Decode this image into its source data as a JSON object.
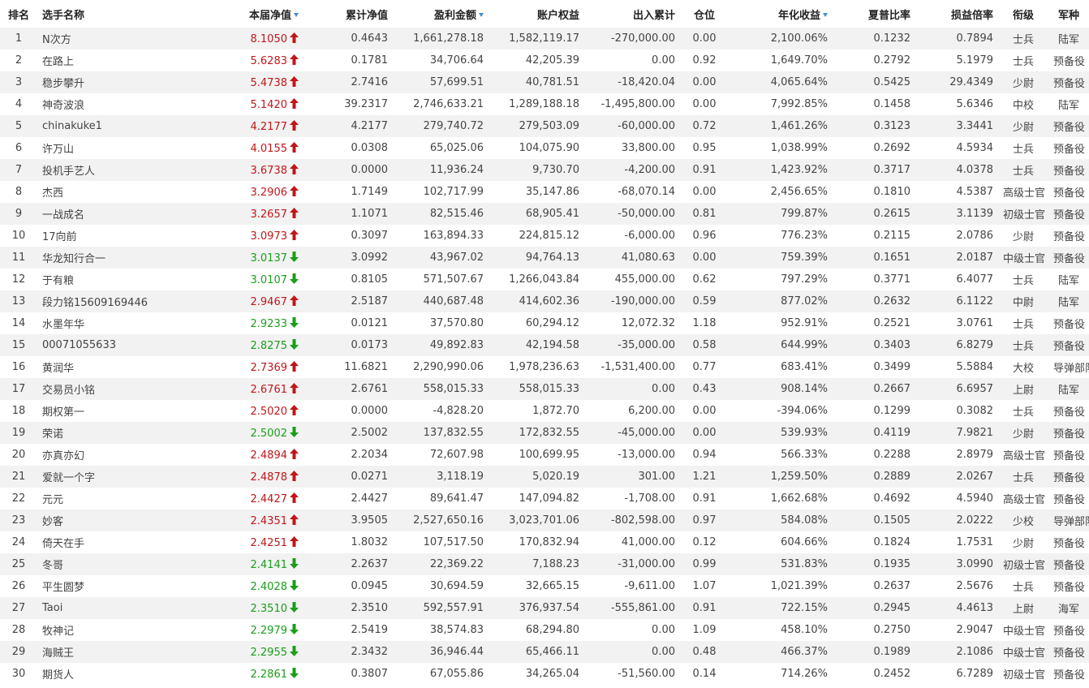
{
  "colors": {
    "up": "#c0161a",
    "down": "#1a9e1a",
    "sort_icon": "#3f8fd2",
    "row_stripe": "#f2f2f2"
  },
  "icons": {
    "up": "arrow-up-icon",
    "down": "arrow-down-icon",
    "sort": "sort-desc-icon"
  },
  "columns": [
    {
      "label": "排名",
      "sortable": false
    },
    {
      "label": "选手名称",
      "sortable": false
    },
    {
      "label": "本届净值",
      "sortable": true
    },
    {
      "label": "累计净值",
      "sortable": false
    },
    {
      "label": "盈利金额",
      "sortable": true
    },
    {
      "label": "账户权益",
      "sortable": false
    },
    {
      "label": "出入累计",
      "sortable": false
    },
    {
      "label": "仓位",
      "sortable": false
    },
    {
      "label": "年化收益",
      "sortable": true
    },
    {
      "label": "夏普比率",
      "sortable": false
    },
    {
      "label": "损益倍率",
      "sortable": false
    },
    {
      "label": "衔级",
      "sortable": false
    },
    {
      "label": "军种",
      "sortable": false
    }
  ],
  "rows": [
    {
      "rank": "1",
      "name": "N次方",
      "nav": "8.1050",
      "trend": "up",
      "cum_nav": "0.4643",
      "profit": "1,661,278.18",
      "equity": "1,582,119.17",
      "flow": "-270,000.00",
      "position": "0.00",
      "annual": "2,100.06%",
      "sharpe": "0.1232",
      "pl_ratio": "0.7894",
      "title": "士兵",
      "branch": "陆军"
    },
    {
      "rank": "2",
      "name": "在路上",
      "nav": "5.6283",
      "trend": "up",
      "cum_nav": "0.1781",
      "profit": "34,706.64",
      "equity": "42,205.39",
      "flow": "0.00",
      "position": "0.92",
      "annual": "1,649.70%",
      "sharpe": "0.2792",
      "pl_ratio": "5.1979",
      "title": "士兵",
      "branch": "预备役"
    },
    {
      "rank": "3",
      "name": "稳步攀升",
      "nav": "5.4738",
      "trend": "up",
      "cum_nav": "2.7416",
      "profit": "57,699.51",
      "equity": "40,781.51",
      "flow": "-18,420.04",
      "position": "0.00",
      "annual": "4,065.64%",
      "sharpe": "0.5425",
      "pl_ratio": "29.4349",
      "title": "少尉",
      "branch": "预备役"
    },
    {
      "rank": "4",
      "name": "神奇波浪",
      "nav": "5.1420",
      "trend": "up",
      "cum_nav": "39.2317",
      "profit": "2,746,633.21",
      "equity": "1,289,188.18",
      "flow": "-1,495,800.00",
      "position": "0.00",
      "annual": "7,992.85%",
      "sharpe": "0.1458",
      "pl_ratio": "5.6346",
      "title": "中校",
      "branch": "陆军"
    },
    {
      "rank": "5",
      "name": "chinakuke1",
      "nav": "4.2177",
      "trend": "up",
      "cum_nav": "4.2177",
      "profit": "279,740.72",
      "equity": "279,503.09",
      "flow": "-60,000.00",
      "position": "0.72",
      "annual": "1,461.26%",
      "sharpe": "0.3123",
      "pl_ratio": "3.3441",
      "title": "少尉",
      "branch": "预备役"
    },
    {
      "rank": "6",
      "name": "许万山",
      "nav": "4.0155",
      "trend": "up",
      "cum_nav": "0.0308",
      "profit": "65,025.06",
      "equity": "104,075.90",
      "flow": "33,800.00",
      "position": "0.95",
      "annual": "1,038.99%",
      "sharpe": "0.2692",
      "pl_ratio": "4.5934",
      "title": "士兵",
      "branch": "预备役"
    },
    {
      "rank": "7",
      "name": "投机手艺人",
      "nav": "3.6738",
      "trend": "up",
      "cum_nav": "0.0000",
      "profit": "11,936.24",
      "equity": "9,730.70",
      "flow": "-4,200.00",
      "position": "0.91",
      "annual": "1,423.92%",
      "sharpe": "0.3717",
      "pl_ratio": "4.0378",
      "title": "士兵",
      "branch": "预备役"
    },
    {
      "rank": "8",
      "name": "杰西",
      "nav": "3.2906",
      "trend": "up",
      "cum_nav": "1.7149",
      "profit": "102,717.99",
      "equity": "35,147.86",
      "flow": "-68,070.14",
      "position": "0.00",
      "annual": "2,456.65%",
      "sharpe": "0.1810",
      "pl_ratio": "4.5387",
      "title": "高级士官",
      "branch": "预备役"
    },
    {
      "rank": "9",
      "name": "一战成名",
      "nav": "3.2657",
      "trend": "up",
      "cum_nav": "1.1071",
      "profit": "82,515.46",
      "equity": "68,905.41",
      "flow": "-50,000.00",
      "position": "0.81",
      "annual": "799.87%",
      "sharpe": "0.2615",
      "pl_ratio": "3.1139",
      "title": "初级士官",
      "branch": "预备役"
    },
    {
      "rank": "10",
      "name": "17向前",
      "nav": "3.0973",
      "trend": "up",
      "cum_nav": "0.3097",
      "profit": "163,894.33",
      "equity": "224,815.12",
      "flow": "-6,000.00",
      "position": "0.96",
      "annual": "776.23%",
      "sharpe": "0.2115",
      "pl_ratio": "2.0786",
      "title": "少尉",
      "branch": "预备役"
    },
    {
      "rank": "11",
      "name": "华龙知行合一",
      "nav": "3.0137",
      "trend": "down",
      "cum_nav": "3.0992",
      "profit": "43,967.02",
      "equity": "94,764.13",
      "flow": "41,080.63",
      "position": "0.00",
      "annual": "759.39%",
      "sharpe": "0.1651",
      "pl_ratio": "2.0187",
      "title": "中级士官",
      "branch": "预备役"
    },
    {
      "rank": "12",
      "name": "于有粮",
      "nav": "3.0107",
      "trend": "down",
      "cum_nav": "0.8105",
      "profit": "571,507.67",
      "equity": "1,266,043.84",
      "flow": "455,000.00",
      "position": "0.62",
      "annual": "797.29%",
      "sharpe": "0.3771",
      "pl_ratio": "6.4077",
      "title": "士兵",
      "branch": "陆军"
    },
    {
      "rank": "13",
      "name": "段力铭15609169446",
      "nav": "2.9467",
      "trend": "up",
      "cum_nav": "2.5187",
      "profit": "440,687.48",
      "equity": "414,602.36",
      "flow": "-190,000.00",
      "position": "0.59",
      "annual": "877.02%",
      "sharpe": "0.2632",
      "pl_ratio": "6.1122",
      "title": "中尉",
      "branch": "陆军"
    },
    {
      "rank": "14",
      "name": "水墨年华",
      "nav": "2.9233",
      "trend": "down",
      "cum_nav": "0.0121",
      "profit": "37,570.80",
      "equity": "60,294.12",
      "flow": "12,072.32",
      "position": "1.18",
      "annual": "952.91%",
      "sharpe": "0.2521",
      "pl_ratio": "3.0761",
      "title": "士兵",
      "branch": "预备役"
    },
    {
      "rank": "15",
      "name": "00071055633",
      "nav": "2.8275",
      "trend": "down",
      "cum_nav": "0.0173",
      "profit": "49,892.83",
      "equity": "42,194.58",
      "flow": "-35,000.00",
      "position": "0.58",
      "annual": "644.99%",
      "sharpe": "0.3403",
      "pl_ratio": "6.8279",
      "title": "士兵",
      "branch": "预备役"
    },
    {
      "rank": "16",
      "name": "黄润华",
      "nav": "2.7369",
      "trend": "up",
      "cum_nav": "11.6821",
      "profit": "2,290,990.06",
      "equity": "1,978,236.63",
      "flow": "-1,531,400.00",
      "position": "0.77",
      "annual": "683.41%",
      "sharpe": "0.3499",
      "pl_ratio": "5.5884",
      "title": "大校",
      "branch": "导弹部队"
    },
    {
      "rank": "17",
      "name": "交易员小铭",
      "nav": "2.6761",
      "trend": "up",
      "cum_nav": "2.6761",
      "profit": "558,015.33",
      "equity": "558,015.33",
      "flow": "0.00",
      "position": "0.43",
      "annual": "908.14%",
      "sharpe": "0.2667",
      "pl_ratio": "6.6957",
      "title": "上尉",
      "branch": "陆军"
    },
    {
      "rank": "18",
      "name": "期权第一",
      "nav": "2.5020",
      "trend": "up",
      "cum_nav": "0.0000",
      "profit": "-4,828.20",
      "equity": "1,872.70",
      "flow": "6,200.00",
      "position": "0.00",
      "annual": "-394.06%",
      "sharpe": "0.1299",
      "pl_ratio": "0.3082",
      "title": "士兵",
      "branch": "预备役"
    },
    {
      "rank": "19",
      "name": "荣诺",
      "nav": "2.5002",
      "trend": "down",
      "cum_nav": "2.5002",
      "profit": "137,832.55",
      "equity": "172,832.55",
      "flow": "-45,000.00",
      "position": "0.00",
      "annual": "539.93%",
      "sharpe": "0.4119",
      "pl_ratio": "7.9821",
      "title": "少尉",
      "branch": "预备役"
    },
    {
      "rank": "20",
      "name": "亦真亦幻",
      "nav": "2.4894",
      "trend": "up",
      "cum_nav": "2.2034",
      "profit": "72,607.98",
      "equity": "100,699.95",
      "flow": "-13,000.00",
      "position": "0.94",
      "annual": "566.33%",
      "sharpe": "0.2288",
      "pl_ratio": "2.8979",
      "title": "高级士官",
      "branch": "预备役"
    },
    {
      "rank": "21",
      "name": "爱就一个字",
      "nav": "2.4878",
      "trend": "up",
      "cum_nav": "0.0271",
      "profit": "3,118.19",
      "equity": "5,020.19",
      "flow": "301.00",
      "position": "1.21",
      "annual": "1,259.50%",
      "sharpe": "0.2889",
      "pl_ratio": "2.0267",
      "title": "士兵",
      "branch": "预备役"
    },
    {
      "rank": "22",
      "name": "元元",
      "nav": "2.4427",
      "trend": "up",
      "cum_nav": "2.4427",
      "profit": "89,641.47",
      "equity": "147,094.82",
      "flow": "-1,708.00",
      "position": "0.91",
      "annual": "1,662.68%",
      "sharpe": "0.4692",
      "pl_ratio": "4.5940",
      "title": "高级士官",
      "branch": "预备役"
    },
    {
      "rank": "23",
      "name": "妙客",
      "nav": "2.4351",
      "trend": "up",
      "cum_nav": "3.9505",
      "profit": "2,527,650.16",
      "equity": "3,023,701.06",
      "flow": "-802,598.00",
      "position": "0.97",
      "annual": "584.08%",
      "sharpe": "0.1505",
      "pl_ratio": "2.0222",
      "title": "少校",
      "branch": "导弹部队"
    },
    {
      "rank": "24",
      "name": "倚天在手",
      "nav": "2.4251",
      "trend": "up",
      "cum_nav": "1.8032",
      "profit": "107,517.50",
      "equity": "170,832.94",
      "flow": "41,000.00",
      "position": "0.12",
      "annual": "604.66%",
      "sharpe": "0.1824",
      "pl_ratio": "1.7531",
      "title": "少尉",
      "branch": "预备役"
    },
    {
      "rank": "25",
      "name": "冬哥",
      "nav": "2.4141",
      "trend": "down",
      "cum_nav": "2.2637",
      "profit": "22,369.22",
      "equity": "7,188.23",
      "flow": "-31,000.00",
      "position": "0.99",
      "annual": "531.83%",
      "sharpe": "0.1935",
      "pl_ratio": "3.0990",
      "title": "初级士官",
      "branch": "预备役"
    },
    {
      "rank": "26",
      "name": "平生圆梦",
      "nav": "2.4028",
      "trend": "down",
      "cum_nav": "0.0945",
      "profit": "30,694.59",
      "equity": "32,665.15",
      "flow": "-9,611.00",
      "position": "1.07",
      "annual": "1,021.39%",
      "sharpe": "0.2637",
      "pl_ratio": "2.5676",
      "title": "士兵",
      "branch": "预备役"
    },
    {
      "rank": "27",
      "name": "Taoi",
      "nav": "2.3510",
      "trend": "down",
      "cum_nav": "2.3510",
      "profit": "592,557.91",
      "equity": "376,937.54",
      "flow": "-555,861.00",
      "position": "0.91",
      "annual": "722.15%",
      "sharpe": "0.2945",
      "pl_ratio": "4.4613",
      "title": "上尉",
      "branch": "海军"
    },
    {
      "rank": "28",
      "name": "牧神记",
      "nav": "2.2979",
      "trend": "down",
      "cum_nav": "2.5419",
      "profit": "38,574.83",
      "equity": "68,294.80",
      "flow": "0.00",
      "position": "1.09",
      "annual": "458.10%",
      "sharpe": "0.2750",
      "pl_ratio": "2.9047",
      "title": "中级士官",
      "branch": "预备役"
    },
    {
      "rank": "29",
      "name": "海贼王",
      "nav": "2.2955",
      "trend": "down",
      "cum_nav": "2.3432",
      "profit": "36,946.44",
      "equity": "65,466.11",
      "flow": "0.00",
      "position": "0.48",
      "annual": "466.37%",
      "sharpe": "0.1989",
      "pl_ratio": "2.1086",
      "title": "中级士官",
      "branch": "预备役"
    },
    {
      "rank": "30",
      "name": "期货人",
      "nav": "2.2861",
      "trend": "down",
      "cum_nav": "0.3807",
      "profit": "67,055.86",
      "equity": "34,265.04",
      "flow": "-51,560.00",
      "position": "0.14",
      "annual": "714.26%",
      "sharpe": "0.2452",
      "pl_ratio": "6.7289",
      "title": "初级士官",
      "branch": "预备役"
    }
  ]
}
